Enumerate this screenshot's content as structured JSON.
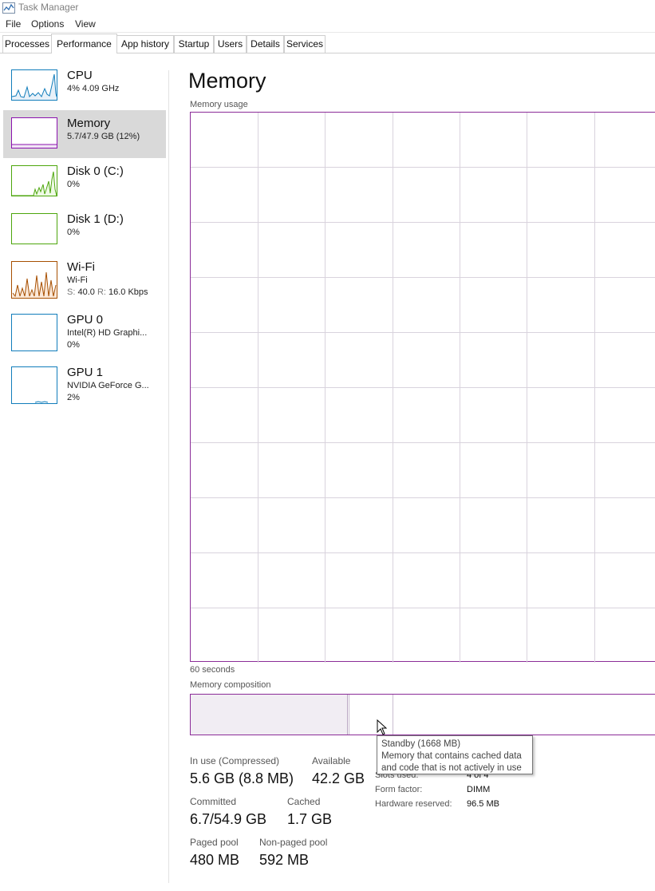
{
  "app": {
    "title": "Task Manager",
    "icon": "task-manager-icon"
  },
  "menu": [
    "File",
    "Options",
    "View"
  ],
  "tabs": [
    "Processes",
    "Performance",
    "App history",
    "Startup",
    "Users",
    "Details",
    "Services"
  ],
  "active_tab": "Performance",
  "sidebar": [
    {
      "name": "CPU",
      "line1": "4% 4.09 GHz",
      "line2": "",
      "color": "#117dbb"
    },
    {
      "name": "Memory",
      "line1": "5.7/47.9 GB (12%)",
      "line2": "",
      "color": "#8b12ae",
      "selected": true
    },
    {
      "name": "Disk 0 (C:)",
      "line1": "0%",
      "line2": "",
      "color": "#4da60c"
    },
    {
      "name": "Disk 1 (D:)",
      "line1": "0%",
      "line2": "",
      "color": "#4da60c"
    },
    {
      "name": "Wi-Fi",
      "line1": "Wi-Fi",
      "line2_s_label": "S:",
      "line2_s": " 40.0 ",
      "line2_r_label": "R:",
      "line2_r": " 16.0 Kbps",
      "color": "#a74f01"
    },
    {
      "name": "GPU 0",
      "line1": "Intel(R) HD Graphi...",
      "line2": "0%",
      "color": "#117dbb"
    },
    {
      "name": "GPU 1",
      "line1": "NVIDIA GeForce G...",
      "line2": "2%",
      "color": "#117dbb"
    }
  ],
  "main": {
    "title": "Memory",
    "usage_label": "Memory usage",
    "time_label": "60 seconds",
    "composition_label": "Memory composition"
  },
  "stats": {
    "in_use_label": "In use (Compressed)",
    "in_use_value": "5.6 GB (8.8 MB)",
    "available_label": "Available",
    "available_value": "42.2 GB",
    "committed_label": "Committed",
    "committed_value": "6.7/54.9 GB",
    "cached_label": "Cached",
    "cached_value": "1.7 GB",
    "paged_label": "Paged pool",
    "paged_value": "480 MB",
    "nonpaged_label": "Non-paged pool",
    "nonpaged_value": "592 MB"
  },
  "details": {
    "slots_label": "Slots used:",
    "slots_value": "4 of 4",
    "form_label": "Form factor:",
    "form_value": "DIMM",
    "reserved_label": "Hardware reserved:",
    "reserved_value": "96.5 MB"
  },
  "tooltip": {
    "line1": "Standby (1668 MB)",
    "line2": "Memory that contains cached data",
    "line3": "and code that is not actively in use"
  },
  "colors": {
    "memory_accent": "#8b2c98",
    "in_use_fill": "#f1edf3",
    "grid": "#d9d3dd"
  }
}
